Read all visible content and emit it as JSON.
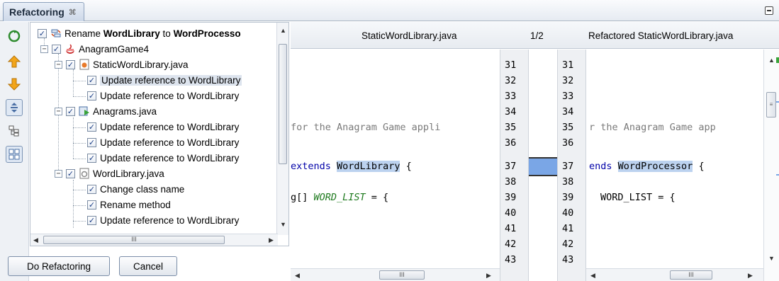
{
  "window": {
    "tab_title": "Refactoring",
    "tab_close_glyph": "⌘"
  },
  "toolbar": {
    "icons": [
      "refresh-icon",
      "previous-occurrence-icon",
      "next-occurrence-icon",
      "expand-collapse-icon",
      "logical-view-icon",
      "physical-view-icon"
    ]
  },
  "tree": {
    "root": {
      "prefix": "Rename ",
      "old": "WordLibrary",
      "mid": " to ",
      "new": "WordProcesso"
    },
    "project": "AnagramGame4",
    "files": [
      {
        "name": "StaticWordLibrary.java",
        "items": [
          "Update reference to WordLibrary",
          "Update reference to WordLibrary"
        ]
      },
      {
        "name": "Anagrams.java",
        "items": [
          "Update reference to WordLibrary",
          "Update reference to WordLibrary",
          "Update reference to WordLibrary"
        ]
      },
      {
        "name": "WordLibrary.java",
        "items": [
          "Change class name",
          "Rename method",
          "Update reference to WordLibrary"
        ]
      }
    ],
    "hscroll_thumb": "III"
  },
  "buttons": {
    "do_refactoring": "Do Refactoring",
    "cancel": "Cancel"
  },
  "diff": {
    "left_title": "StaticWordLibrary.java",
    "counter": "1/2",
    "right_title": "Refactored StaticWordLibrary.java",
    "line_numbers": [
      "31",
      "32",
      "33",
      "34",
      "35",
      "36",
      "37",
      "38",
      "39",
      "40",
      "41",
      "42",
      "43"
    ],
    "left_line35": "for the Anagram Game appli",
    "left_line37_kw": "extends",
    "left_line37_ident": "WordLibrary",
    "left_line37_tail": " {",
    "left_line39_pre": "g[] ",
    "left_line39_const": "WORD_LIST",
    "left_line39_tail": " = {",
    "right_line35": "r the Anagram Game app",
    "right_line37_kw": "ends",
    "right_line37_ident": "WordProcessor",
    "right_line37_tail": " {",
    "right_line39": "WORD_LIST = {",
    "scroll_thumb": "III"
  },
  "colors": {
    "highlight_ident": "#bcd2ef",
    "keyword": "#0000a8",
    "constant": "#1e7a1e",
    "change_marker": "#7aa6e6"
  }
}
